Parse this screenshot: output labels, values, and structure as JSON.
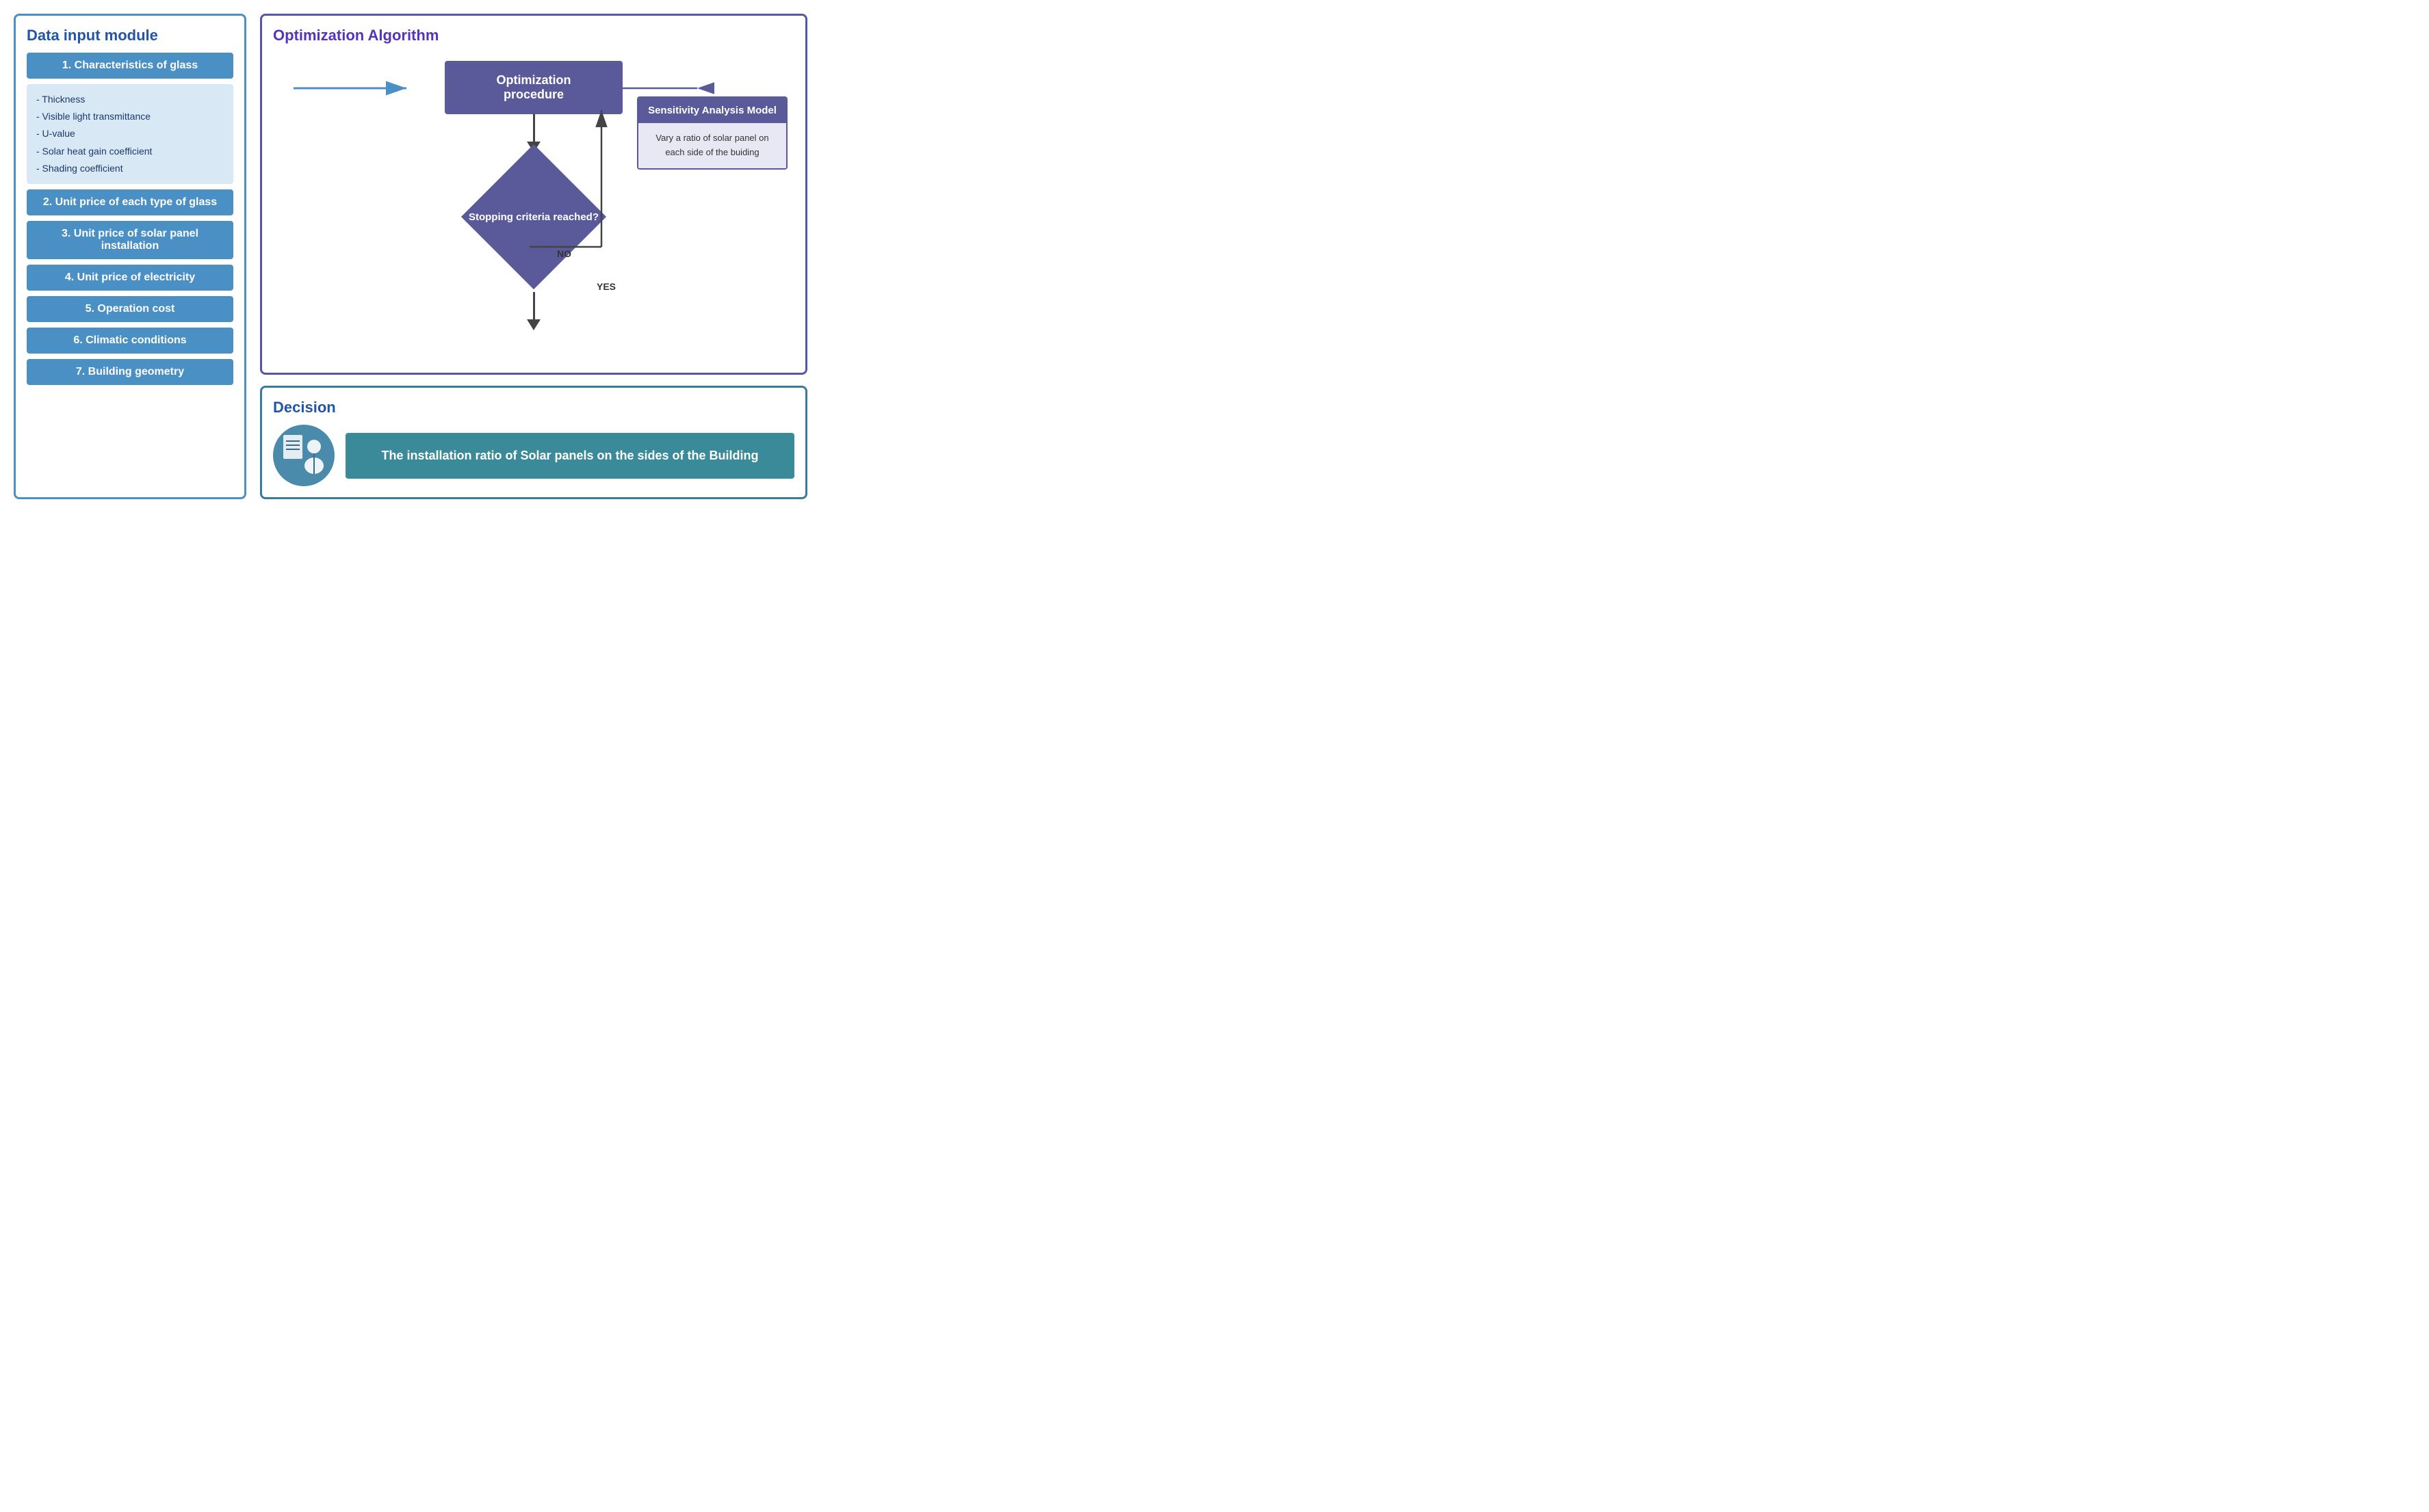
{
  "leftPanel": {
    "title": "Data input module",
    "items": [
      {
        "id": "item1",
        "label": "1. Characteristics of glass",
        "hasDetails": true,
        "details": [
          "- Thickness",
          "- Visible light transmittance",
          "- U-value",
          "- Solar heat gain coefficient",
          "- Shading coefficient"
        ]
      },
      {
        "id": "item2",
        "label": "2. Unit price of each type of glass",
        "hasDetails": false
      },
      {
        "id": "item3",
        "label": "3. Unit price of solar panel installation",
        "hasDetails": false
      },
      {
        "id": "item4",
        "label": "4. Unit price of electricity",
        "hasDetails": false
      },
      {
        "id": "item5",
        "label": "5. Operation cost",
        "hasDetails": false
      },
      {
        "id": "item6",
        "label": "6. Climatic conditions",
        "hasDetails": false
      },
      {
        "id": "item7",
        "label": "7. Building geometry",
        "hasDetails": false
      }
    ]
  },
  "optimizationSection": {
    "title": "Optimization Algorithm",
    "procedureLabel": "Optimization procedure",
    "diamondLabel": "Stopping criteria reached?",
    "noLabel": "NO",
    "yesLabel": "YES"
  },
  "sensitivityBox": {
    "title": "Sensitivity Analysis Model",
    "body": "Vary a ratio of solar panel on each side of the buiding"
  },
  "decisionSection": {
    "title": "Decision",
    "resultLabel": "The installation ratio of Solar panels on the sides of the Building"
  }
}
